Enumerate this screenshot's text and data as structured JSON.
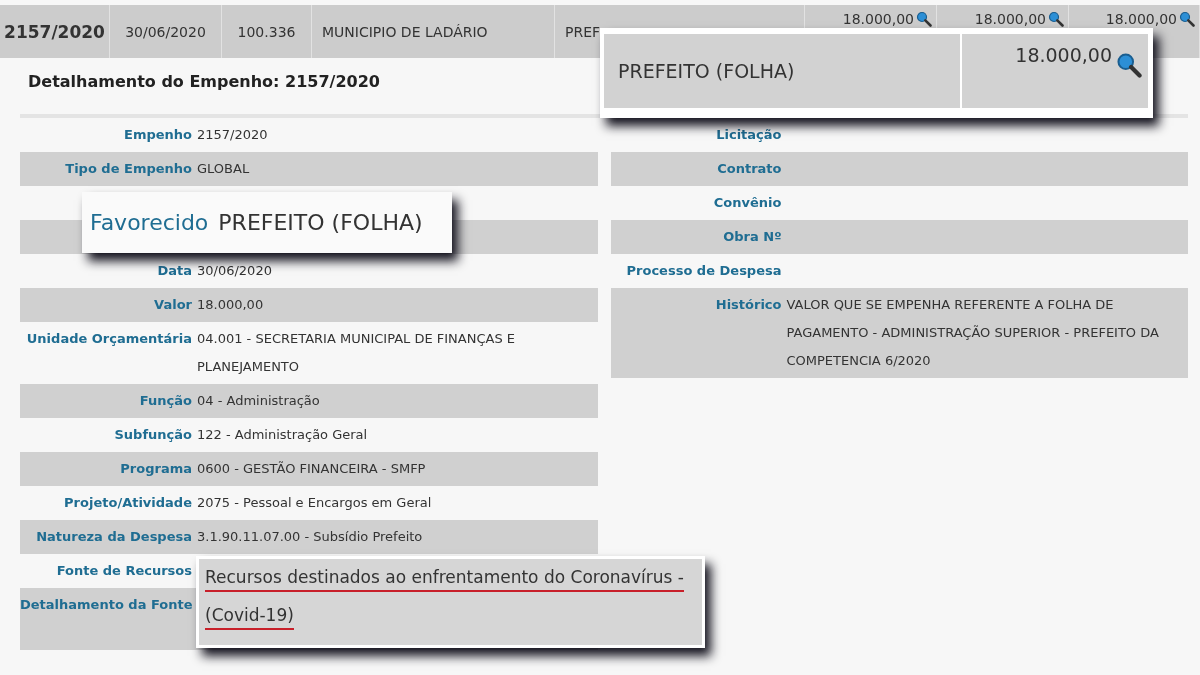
{
  "results_row": {
    "cells": [
      "2157/2020",
      "30/06/2020",
      "100.336",
      "MUNICIPIO DE LADÁRIO",
      "PREF"
    ],
    "amounts": [
      "18.000,00",
      "18.000,00",
      "18.000,00"
    ]
  },
  "detail": {
    "title": "Detalhamento do Empenho: 2157/2020",
    "left_rows": [
      {
        "label": "Empenho",
        "value": "2157/2020"
      },
      {
        "label": "Tipo de Empenho",
        "value": "GLOBAL"
      },
      {},
      {},
      {
        "label": "Data",
        "value": "30/06/2020"
      },
      {
        "label": "Valor",
        "value": "18.000,00"
      },
      {
        "label": "Unidade Orçamentária",
        "value": "04.001 - SECRETARIA MUNICIPAL DE FINANÇAS E PLANEJAMENTO"
      },
      {
        "label": "Função",
        "value": "04 - Administração"
      },
      {
        "label": "Subfunção",
        "value": "122 - Administração Geral"
      },
      {
        "label": "Programa",
        "value": "0600 - GESTÃO FINANCEIRA - SMFP"
      },
      {
        "label": "Projeto/Atividade",
        "value": "2075 - Pessoal e Encargos em Geral"
      },
      {
        "label": "Natureza da Despesa",
        "value": "3.1.90.11.07.00 - Subsídio Prefeito"
      },
      {
        "label": "Fonte de Recursos"
      },
      {
        "label": "Detalhamento da Fonte",
        "tall": true
      }
    ],
    "right_rows": [
      {
        "label": "Licitação"
      },
      {
        "label": "Contrato"
      },
      {
        "label": "Convênio"
      },
      {
        "label": "Obra Nº"
      },
      {
        "label": "Processo de Despesa"
      },
      {
        "label": "Histórico",
        "value": "VALOR QUE SE EMPENHA REFERENTE A FOLHA DE PAGAMENTO - ADMINISTRAÇÃO SUPERIOR - PREFEITO DA COMPETENCIA 6/2020"
      }
    ]
  },
  "callouts": [
    {
      "kind": "table",
      "cell": "PREFEITO (FOLHA)",
      "amount": "18.000,00"
    },
    {
      "kind": "field",
      "label": "Favorecido",
      "value": "PREFEITO (FOLHA)"
    },
    {
      "kind": "text",
      "lines": [
        "Recursos destinados ao enfrentamento do Coronavírus -",
        "(Covid-19)"
      ],
      "underlined": true
    }
  ]
}
